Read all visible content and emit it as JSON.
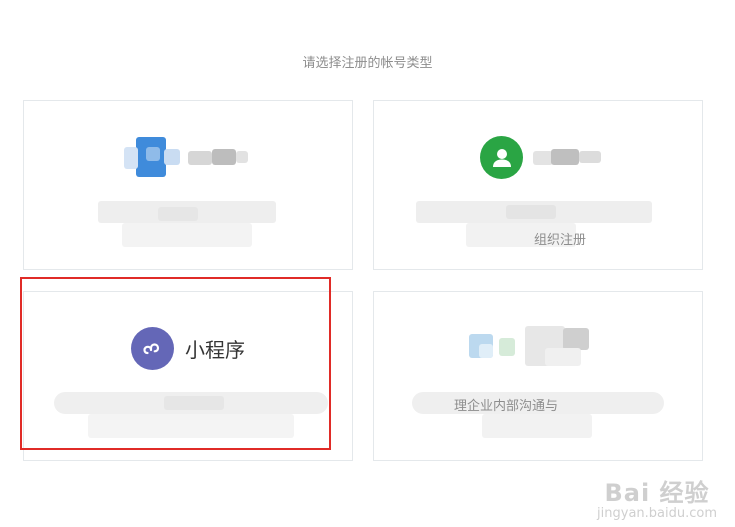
{
  "page": {
    "title": "请选择注册的帐号类型"
  },
  "cards": [
    {
      "title": "",
      "description": "",
      "icon": "blurred-blue-icon",
      "accent": "#3a87d9"
    },
    {
      "title": "",
      "description": "组织注册",
      "icon": "person-icon",
      "accent": "#2aa544"
    },
    {
      "title": "小程序",
      "description": "",
      "icon": "mini-program-icon",
      "accent": "#6467b7",
      "highlighted": true
    },
    {
      "title": "",
      "description": "理企业内部沟通与",
      "icon": "blurred-icon",
      "accent": "#9cc7e8"
    }
  ],
  "watermark": {
    "top": "Bai 经验",
    "bottom": "jingyan.baidu.com"
  },
  "colors": {
    "highlight": "#e02b27",
    "card_border": "#e4e8eb",
    "subtitle": "#8d8d8d"
  }
}
